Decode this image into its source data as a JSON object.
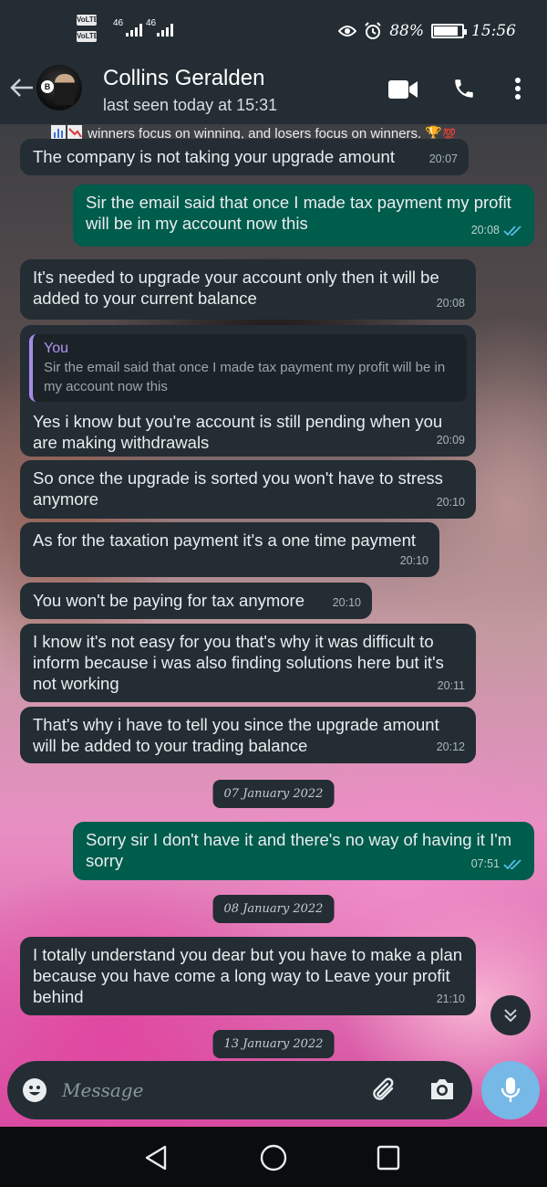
{
  "status_bar": {
    "volte1": "VoLTE",
    "volte2": "VoLTE",
    "net1": "46",
    "net2": "46",
    "battery": "88%",
    "battery_level": 0.88,
    "time": "15:56"
  },
  "header": {
    "contact_name": "Collins Geralden",
    "last_seen": "last seen today at 15:31",
    "avatar_mark": "B",
    "icons": [
      "back-arrow-icon",
      "video-call-icon",
      "phone-icon",
      "more-options-icon"
    ]
  },
  "messages": {
    "fragment": "winners focus on winning,  and losers focus on winners.",
    "m1": {
      "text": "The company is not taking your upgrade amount",
      "time": "20:07"
    },
    "m2": {
      "text": "Sir the email said that once I made tax payment my profit will be in my account  now this",
      "time": "20:08"
    },
    "m3": {
      "text": "It's needed to upgrade your account only then it will be added to your current balance",
      "time": "20:08"
    },
    "m4": {
      "quote_author": "You",
      "quote_text": "Sir the email said that once I made tax payment my profit will be in my account  now this",
      "text": "Yes i know but you're account is still pending when you are making withdrawals",
      "time": "20:09"
    },
    "m5": {
      "text": "So once the upgrade is sorted you won't have to stress anymore",
      "time": "20:10"
    },
    "m6": {
      "text": "As for the taxation payment it's a one time payment",
      "time": "20:10"
    },
    "m7": {
      "text": "You won't be paying for tax anymore",
      "time": "20:10"
    },
    "m8": {
      "text": "I know it's not easy for you that's why it was difficult to inform because i was also finding solutions  here but it's not working",
      "time": "20:11"
    },
    "m9": {
      "text": "That's why i have to tell you since the upgrade amount will be added to your trading balance",
      "time": "20:12"
    },
    "date1": "07 January 2022",
    "m10": {
      "text": "Sorry sir I don't have it and there's no way of having it I'm sorry",
      "time": "07:51"
    },
    "date2": "08 January 2022",
    "m11": {
      "text": "I totally understand you dear but you have to make a plan because you have come a long way to Leave your profit behind",
      "time": "21:10"
    },
    "date3": "13 January 2022"
  },
  "composer": {
    "placeholder": "Message"
  },
  "colors": {
    "incoming_bubble": "#232d33",
    "outgoing_bubble": "#005c4b",
    "read_ticks": "#53bdeb",
    "mic_button": "#76b8e6"
  }
}
